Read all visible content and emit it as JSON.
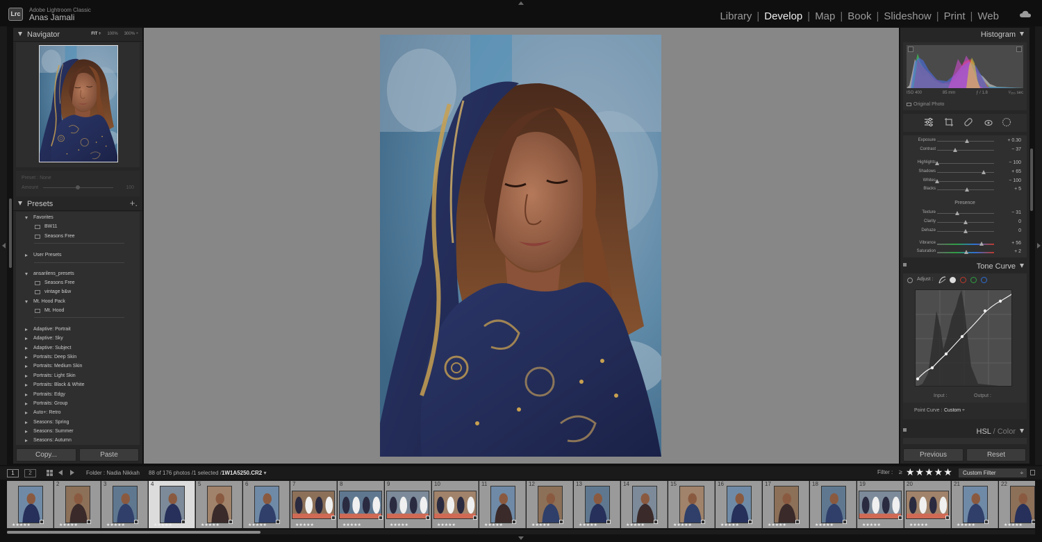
{
  "app": {
    "name": "Adobe Lightroom Classic",
    "logo": "Lrc",
    "user": "Anas Jamali"
  },
  "modules": [
    {
      "label": "Library",
      "active": false
    },
    {
      "label": "Develop",
      "active": true
    },
    {
      "label": "Map",
      "active": false
    },
    {
      "label": "Book",
      "active": false
    },
    {
      "label": "Slideshow",
      "active": false
    },
    {
      "label": "Print",
      "active": false
    },
    {
      "label": "Web",
      "active": false
    }
  ],
  "module_separator": "|",
  "navigator": {
    "title": "Navigator",
    "zoom_options": [
      "FIT ÷",
      "100%",
      "300% ÷"
    ]
  },
  "preset_amount": {
    "preset_label": "Preset : None",
    "amount_label": "Amount",
    "amount_value": "100"
  },
  "presets": {
    "title": "Presets",
    "add_label": "+.",
    "items": [
      {
        "label": "Favorites",
        "type": "group",
        "open": true
      },
      {
        "label": "BW11",
        "type": "preset"
      },
      {
        "label": "Seasons Free",
        "type": "preset"
      },
      {
        "label": "User Presets",
        "type": "group",
        "open": false
      },
      {
        "label": "ansarilens_presets",
        "type": "group",
        "open": true
      },
      {
        "label": "Seasons Free",
        "type": "preset"
      },
      {
        "label": "vintage b&w",
        "type": "preset"
      },
      {
        "label": "Mt. Hood Pack",
        "type": "group",
        "open": true
      },
      {
        "label": "Mt. Hood",
        "type": "preset"
      },
      {
        "label": "Adaptive: Portrait",
        "type": "group",
        "open": false
      },
      {
        "label": "Adaptive: Sky",
        "type": "group",
        "open": false
      },
      {
        "label": "Adaptive: Subject",
        "type": "group",
        "open": false
      },
      {
        "label": "Portraits: Deep Skin",
        "type": "group",
        "open": false
      },
      {
        "label": "Portraits: Medium Skin",
        "type": "group",
        "open": false
      },
      {
        "label": "Portraits: Light Skin",
        "type": "group",
        "open": false
      },
      {
        "label": "Portraits: Black & White",
        "type": "group",
        "open": false
      },
      {
        "label": "Portraits: Edgy",
        "type": "group",
        "open": false
      },
      {
        "label": "Portraits: Group",
        "type": "group",
        "open": false
      },
      {
        "label": "Auto+: Retro",
        "type": "group",
        "open": false
      },
      {
        "label": "Seasons: Spring",
        "type": "group",
        "open": false
      },
      {
        "label": "Seasons: Summer",
        "type": "group",
        "open": false
      },
      {
        "label": "Seasons: Autumn",
        "type": "group",
        "open": false
      }
    ]
  },
  "left_buttons": {
    "copy": "Copy...",
    "paste": "Paste"
  },
  "histogram": {
    "title": "Histogram",
    "exif": {
      "iso": "ISO 400",
      "focal": "85 mm",
      "aperture": "ƒ / 1.8",
      "shutter": "¹⁄₂₅₀ sec"
    },
    "original_photo": "Original Photo"
  },
  "basic": {
    "sliders": [
      {
        "label": "Exposure",
        "value": "+ 0.30",
        "pos": 0.53
      },
      {
        "label": "Contrast",
        "value": "− 37",
        "pos": 0.32
      },
      {
        "label": "Highlights",
        "value": "− 100",
        "pos": 0.0
      },
      {
        "label": "Shadows",
        "value": "+ 65",
        "pos": 0.82
      },
      {
        "label": "Whites",
        "value": "− 100",
        "pos": 0.0
      },
      {
        "label": "Blacks",
        "value": "+ 5",
        "pos": 0.52
      },
      {
        "label": "Texture",
        "value": "− 31",
        "pos": 0.35
      },
      {
        "label": "Clarity",
        "value": "0",
        "pos": 0.5
      },
      {
        "label": "Dehaze",
        "value": "0",
        "pos": 0.5
      },
      {
        "label": "Vibrance",
        "value": "+ 56",
        "pos": 0.78
      },
      {
        "label": "Saturation",
        "value": "+ 2",
        "pos": 0.51
      }
    ],
    "presence_title": "Presence"
  },
  "tone_curve": {
    "title": "Tone Curve",
    "adjust_label": "Adjust :",
    "input_label": "Input :",
    "output_label": "Output :",
    "point_curve_label": "Point Curve :",
    "point_curve_value": "Custom ÷"
  },
  "hsl": {
    "title_main": "HSL",
    "title_sep": " / ",
    "title_dim": "Color"
  },
  "right_buttons": {
    "previous": "Previous",
    "reset": "Reset"
  },
  "filmstrip_bar": {
    "view1": "1",
    "view2": "2",
    "folder": "Folder : Nadia Nikkah",
    "count": "88 of 176 photos /1 selected /",
    "filename": "1W1A5250.CR2",
    "filename_suffix": " ▾",
    "filter_label": "Filter :",
    "filter_op": "≥",
    "filter_stars": "★★★★★",
    "custom_filter": "Custom Filter",
    "custom_filter_arrow": "÷"
  },
  "filmstrip": [
    {
      "num": "",
      "kind": "portrait",
      "stars": "★★★★★"
    },
    {
      "num": "2",
      "kind": "portrait",
      "stars": "★★★★★"
    },
    {
      "num": "3",
      "kind": "portrait",
      "stars": "★★★★★"
    },
    {
      "num": "4",
      "kind": "portrait",
      "stars": "★★★★★",
      "selected": true
    },
    {
      "num": "5",
      "kind": "portrait",
      "stars": "★★★★★"
    },
    {
      "num": "6",
      "kind": "portrait",
      "stars": "★★★★★"
    },
    {
      "num": "7",
      "kind": "landscape",
      "stars": "★★★★★"
    },
    {
      "num": "8",
      "kind": "landscape",
      "stars": "★★★★★"
    },
    {
      "num": "9",
      "kind": "landscape",
      "stars": "★★★★★"
    },
    {
      "num": "10",
      "kind": "landscape",
      "stars": "★★★★★"
    },
    {
      "num": "11",
      "kind": "portrait",
      "stars": "★★★★★"
    },
    {
      "num": "12",
      "kind": "portrait",
      "stars": "★★★★★"
    },
    {
      "num": "13",
      "kind": "portrait",
      "stars": "★★★★★"
    },
    {
      "num": "14",
      "kind": "portrait",
      "stars": "★★★★★"
    },
    {
      "num": "15",
      "kind": "portrait",
      "stars": "★★★★★"
    },
    {
      "num": "16",
      "kind": "portrait",
      "stars": "★★★★★"
    },
    {
      "num": "17",
      "kind": "portrait",
      "stars": "★★★★★"
    },
    {
      "num": "18",
      "kind": "portrait",
      "stars": "★★★★★"
    },
    {
      "num": "19",
      "kind": "landscape",
      "stars": "★★★★★"
    },
    {
      "num": "20",
      "kind": "landscape",
      "stars": "★★★★★"
    },
    {
      "num": "21",
      "kind": "portrait",
      "stars": "★★★★★"
    },
    {
      "num": "22",
      "kind": "portrait",
      "stars": "★★★★★"
    }
  ],
  "colors": {
    "accent_red": "#c0392b",
    "accent_green": "#2ea043",
    "accent_blue": "#2f6fd6",
    "shawl_navy": "#26305a",
    "gold": "#c8a050"
  }
}
